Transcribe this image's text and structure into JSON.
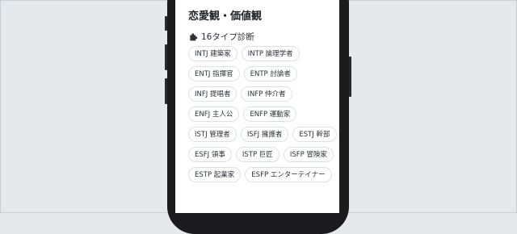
{
  "section": {
    "title": "恋愛観・価値観"
  },
  "mbti": {
    "header_icon": "puzzle-icon",
    "header_label": "16タイプ診断",
    "types": [
      "INTJ 建築家",
      "INTP 論理学者",
      "ENTJ 指揮官",
      "ENTP 討論者",
      "INFJ 提唱者",
      "INFP 仲介者",
      "ENFJ 主人公",
      "ENFP 運動家",
      "ISTJ 管理者",
      "ISFJ 擁護者",
      "ESTJ 幹部",
      "ESFJ 領事",
      "ISTP 巨匠",
      "ISFP 冒険家",
      "ESTP 起業家",
      "ESFP エンターテイナー"
    ]
  },
  "colors": {
    "background": "#e6e9ec",
    "phone_frame": "#1b1b1d",
    "screen": "#ffffff",
    "chip_border": "#dde1e5",
    "text": "#1f2328"
  }
}
